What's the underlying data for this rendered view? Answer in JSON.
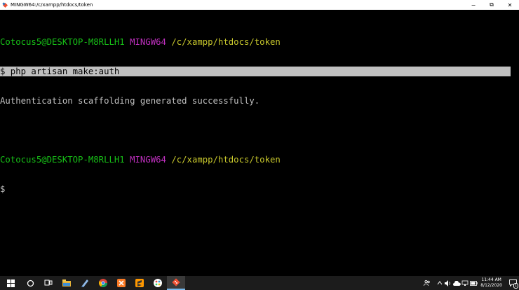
{
  "window": {
    "title": "MINGW64:/c/xampp/htdocs/token",
    "minimize_glyph": "−",
    "maximize_glyph": "⧉",
    "close_glyph": "✕"
  },
  "terminal": {
    "prompt1": {
      "user_host": "Cotocus5@DESKTOP-M8RLLH1",
      "shell": "MINGW64",
      "path": "/c/xampp/htdocs/token"
    },
    "command": "$ php artisan make:auth",
    "output": "Authentication scaffolding generated successfully.",
    "prompt2": {
      "user_host": "Cotocus5@DESKTOP-M8RLLH1",
      "shell": "MINGW64",
      "path": "/c/xampp/htdocs/token"
    },
    "cursor_line": "$"
  },
  "taskbar": {
    "items": [
      "windows-start",
      "cortana-search",
      "task-view",
      "file-explorer",
      "notepad",
      "chrome",
      "xampp",
      "sublime-text",
      "paint-3d",
      "git-bash"
    ],
    "tray": {
      "time": "11:44 AM",
      "date": "8/12/2020",
      "notification_count": "1"
    }
  },
  "colors": {
    "terminal_bg": "#000000",
    "terminal_text": "#c0c0c0",
    "user_host": "#17c017",
    "shell": "#c030c0",
    "path": "#c7c72c",
    "selection": "#c0c0c0"
  }
}
